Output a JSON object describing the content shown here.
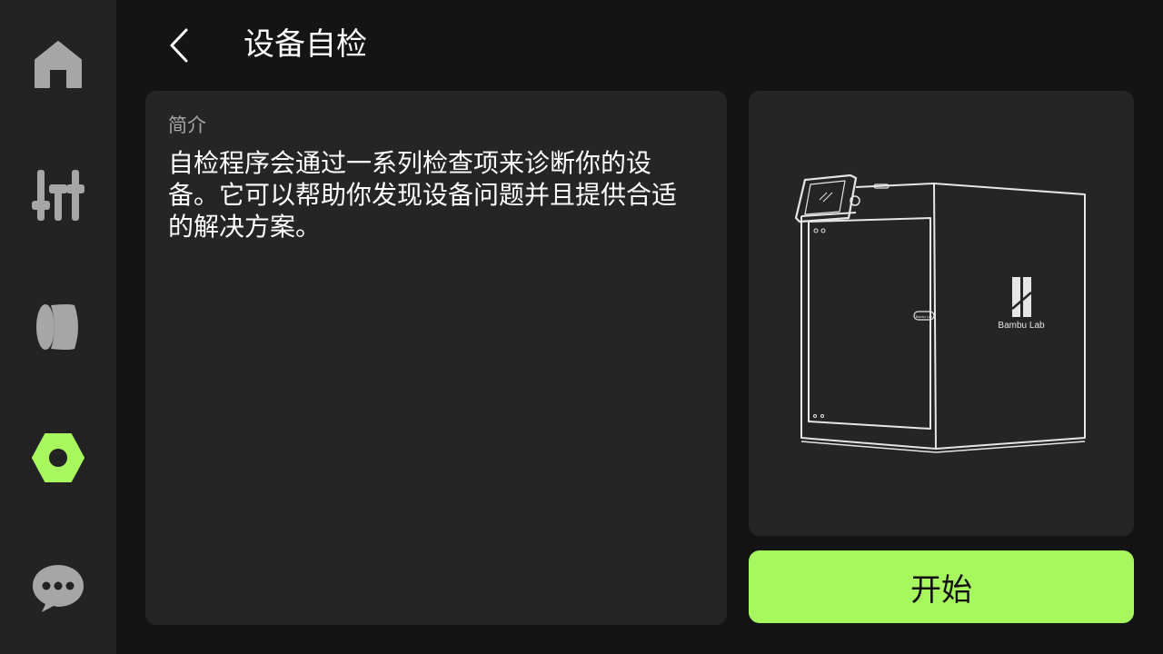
{
  "sidebar": {
    "items": [
      {
        "icon": "home-icon",
        "active": false
      },
      {
        "icon": "controls-icon",
        "active": false
      },
      {
        "icon": "filament-icon",
        "active": false
      },
      {
        "icon": "settings-nut-icon",
        "active": true
      },
      {
        "icon": "message-icon",
        "active": false
      }
    ],
    "active_color": "#a7f75f",
    "inactive_color": "#a6a6a6"
  },
  "header": {
    "back_icon": "chevron-left-icon",
    "title": "设备自检"
  },
  "intro": {
    "label": "简介",
    "text": "自检程序会通过一系列检查项来诊断你的设备。它可以帮助你发现设备问题并且提供合适的解决方案。"
  },
  "device_image": {
    "icon": "printer-illustration",
    "brand": "Bambu Lab",
    "door_badge": "Bambu Lab"
  },
  "actions": {
    "start_label": "开始"
  },
  "colors": {
    "accent": "#a7f75f",
    "background": "#141414",
    "panel": "#252525",
    "sidebar": "#232323"
  }
}
